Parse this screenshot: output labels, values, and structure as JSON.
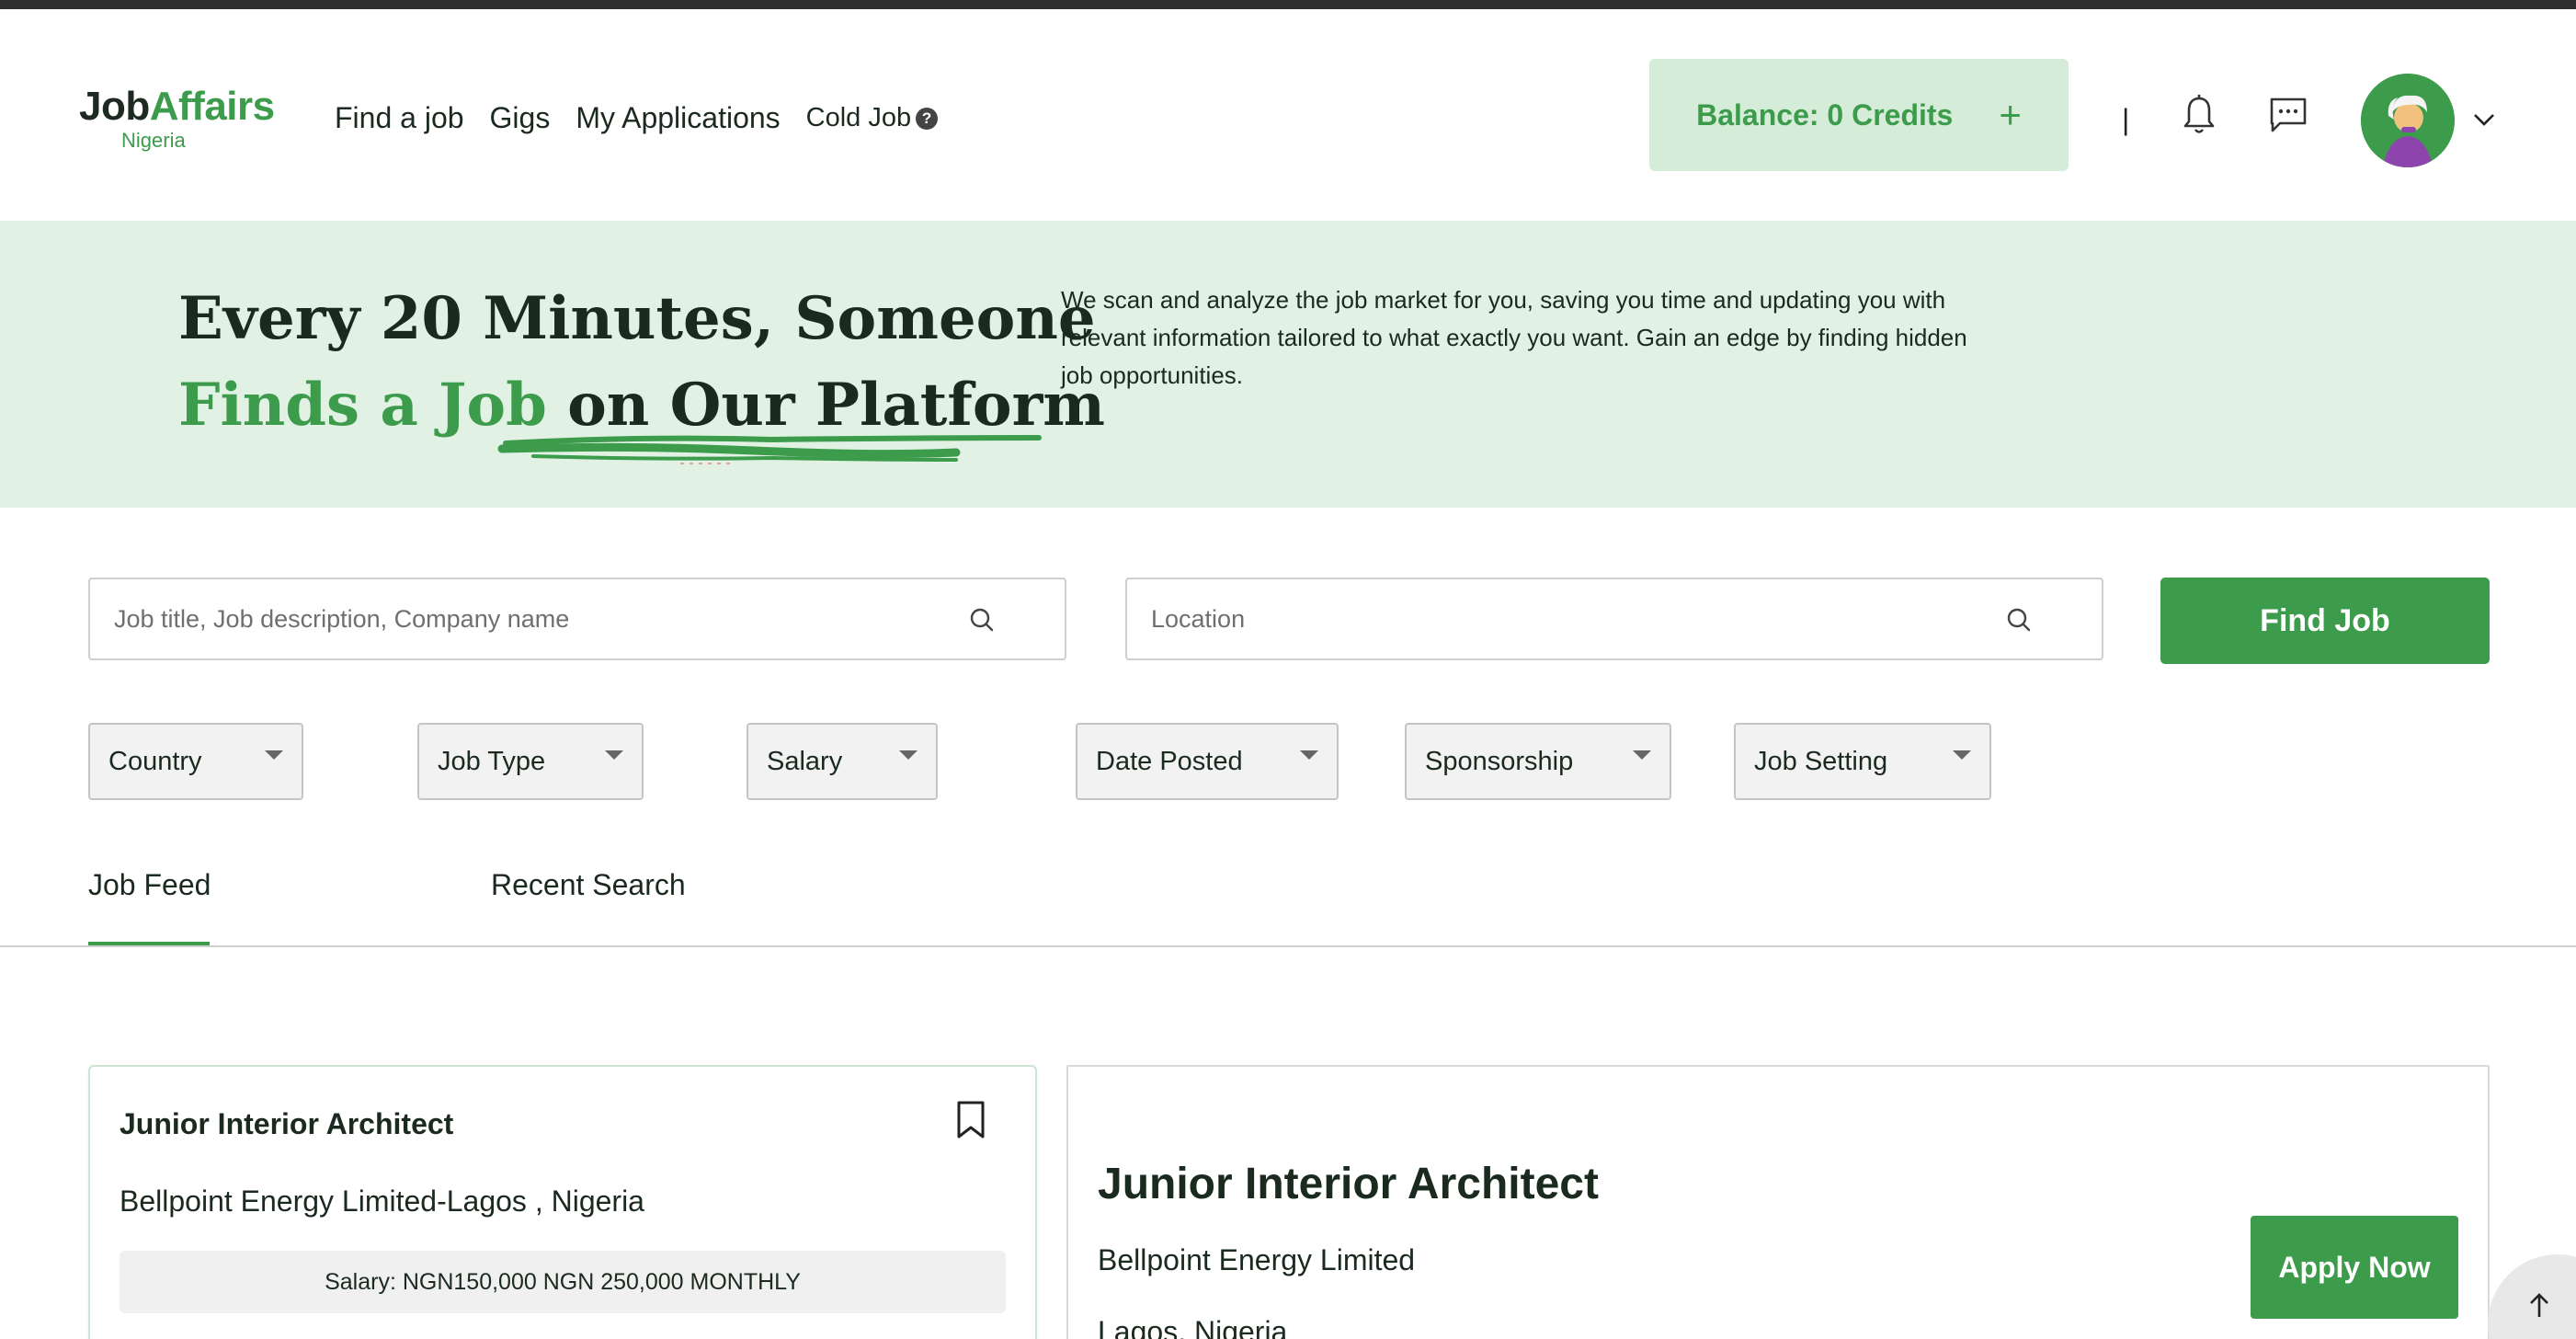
{
  "header": {
    "logo_job": "Job",
    "logo_affairs": "Affairs",
    "logo_sub": "Nigeria",
    "nav": [
      "Find a job",
      "Gigs",
      "My Applications"
    ],
    "cold_job": "Cold Job",
    "cold_job_help": "?",
    "balance": "Balance: 0 Credits",
    "balance_plus": "+",
    "separator": "|"
  },
  "hero": {
    "line1": "Every 20 Minutes, Someone",
    "line2_green": "Finds a Job",
    "line2_rest": " on Our Platform",
    "description": "We scan and analyze the job market for you, saving you time and updating you with relevant information tailored to what exactly you want. Gain an edge by finding hidden job opportunities."
  },
  "search": {
    "title_placeholder": "Job title, Job description, Company name",
    "location_placeholder": "Location",
    "button": "Find Job"
  },
  "filters": [
    "Country",
    "Job Type",
    "Salary",
    "Date Posted",
    "Sponsorship",
    "Job Setting"
  ],
  "tabs": [
    "Job Feed",
    "Recent Search"
  ],
  "job_card": {
    "title": "Junior Interior Architect",
    "company_location": "Bellpoint Energy Limited-Lagos , Nigeria",
    "salary": "Salary: NGN150,000 NGN 250,000 MONTHLY"
  },
  "detail": {
    "title": "Junior Interior Architect",
    "company": "Bellpoint Energy Limited",
    "location": "Lagos, Nigeria",
    "apply": "Apply Now"
  },
  "colors": {
    "brand_green": "#3d9b4c",
    "hero_bg": "#e1f1e4",
    "balance_bg": "#d4ecd8"
  },
  "icons": [
    "search-icon",
    "bell-icon",
    "chat-icon",
    "avatar",
    "chevron-down-icon",
    "bookmark-icon",
    "arrow-up-icon",
    "help-icon"
  ]
}
